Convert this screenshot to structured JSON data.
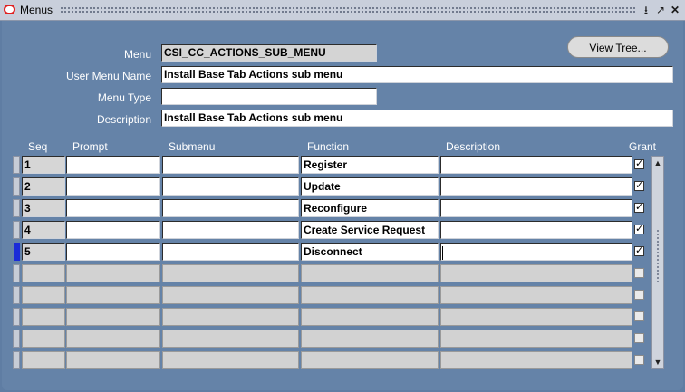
{
  "window": {
    "title": "Menus",
    "controls": [
      "minimize",
      "maximize",
      "close"
    ]
  },
  "form": {
    "menu_label": "Menu",
    "menu_value": "CSI_CC_ACTIONS_SUB_MENU",
    "user_menu_name_label": "User Menu Name",
    "user_menu_name_value": "Install Base Tab Actions sub menu",
    "menu_type_label": "Menu Type",
    "menu_type_value": "",
    "description_label": "Description",
    "description_value": "Install Base Tab Actions sub menu",
    "view_tree_label": "View Tree..."
  },
  "table": {
    "columns": {
      "seq": "Seq",
      "prompt": "Prompt",
      "submenu": "Submenu",
      "function": "Function",
      "description": "Description",
      "grant": "Grant"
    },
    "rows": [
      {
        "seq": "1",
        "prompt": "",
        "submenu": "",
        "function": "Register",
        "description": "",
        "grant": true
      },
      {
        "seq": "2",
        "prompt": "",
        "submenu": "",
        "function": "Update",
        "description": "",
        "grant": true
      },
      {
        "seq": "3",
        "prompt": "",
        "submenu": "",
        "function": "Reconfigure",
        "description": "",
        "grant": true
      },
      {
        "seq": "4",
        "prompt": "",
        "submenu": "",
        "function": "Create Service Request",
        "description": "",
        "grant": true
      },
      {
        "seq": "5",
        "prompt": "",
        "submenu": "",
        "function": "Disconnect",
        "description": "",
        "grant": true
      }
    ],
    "empty_rows": 5,
    "active_row": 5
  },
  "colors": {
    "background": "#6583a8",
    "titlebar": "#c9cfdb",
    "row_indicator": "#1a2bd8"
  }
}
